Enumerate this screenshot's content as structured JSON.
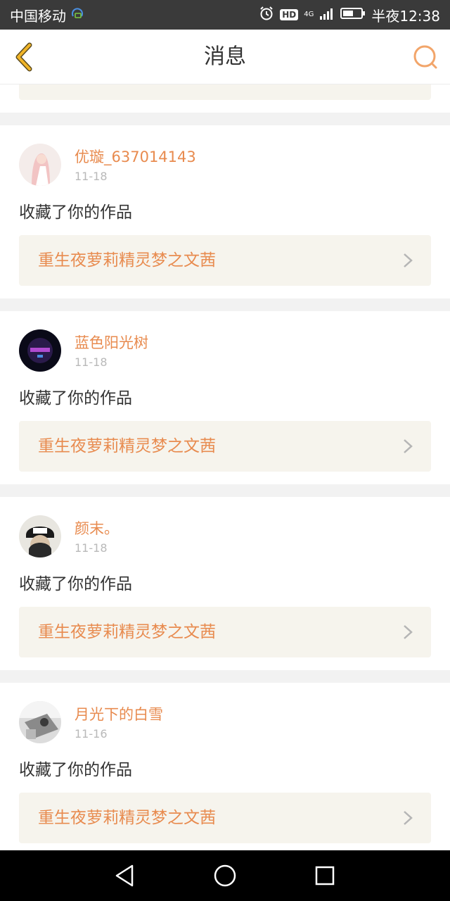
{
  "status_bar": {
    "carrier": "中国移动",
    "hd": "HD",
    "network": "4G",
    "time": "半夜12:38"
  },
  "header": {
    "title": "消息",
    "back_icon": "chevron-left-icon",
    "search_icon": "search-icon"
  },
  "colors": {
    "accent": "#e88b4f",
    "back_icon": "#f0b428",
    "box_bg": "#f6f4ed",
    "page_bg": "#f2f2f2"
  },
  "messages": [
    {
      "username": "优璇_637014143",
      "date": "11-18",
      "action": "收藏了你的作品",
      "work_title": "重生夜萝莉精灵梦之文茜"
    },
    {
      "username": "蓝色阳光树",
      "date": "11-18",
      "action": "收藏了你的作品",
      "work_title": "重生夜萝莉精灵梦之文茜"
    },
    {
      "username": "颜末。",
      "date": "11-18",
      "action": "收藏了你的作品",
      "work_title": "重生夜萝莉精灵梦之文茜"
    },
    {
      "username": "月光下的白雪",
      "date": "11-16",
      "action": "收藏了你的作品",
      "work_title": "重生夜萝莉精灵梦之文茜"
    }
  ]
}
